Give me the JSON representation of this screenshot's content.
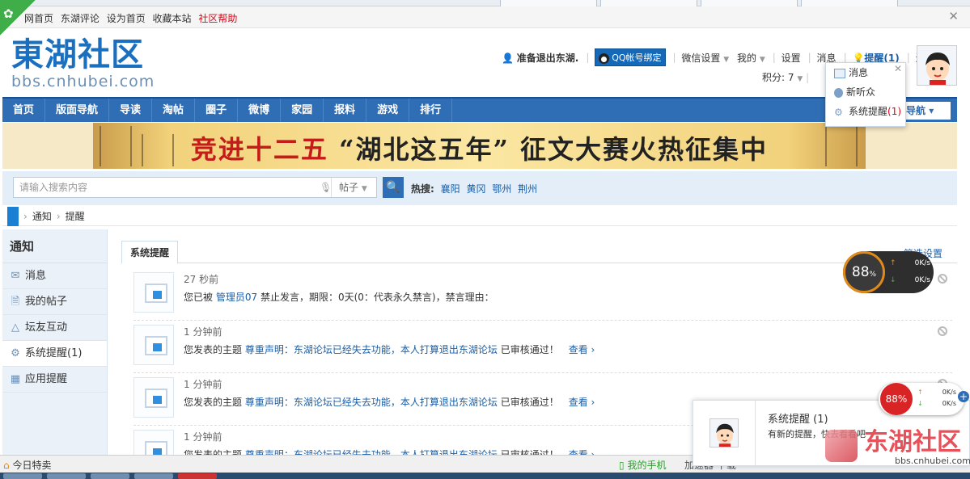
{
  "top_links": {
    "items": [
      "网首页",
      "东湖评论",
      "设为首页",
      "收藏本站"
    ],
    "help": "社区帮助"
  },
  "logo": {
    "name": "東湖社区",
    "url_text": "bbs.cnhubei.com"
  },
  "user_bar": {
    "exit_notice": "准备退出东湖.",
    "qq_bind": "QQ帐号绑定",
    "wechat": "微信设置",
    "mine": "我的",
    "settings": "设置",
    "messages": "消息",
    "remind": "提醒(1)",
    "logout": "退出",
    "points": "积分: 7"
  },
  "remind_dropdown": {
    "items": [
      {
        "label": "消息",
        "count": ""
      },
      {
        "label": "新听众",
        "count": ""
      },
      {
        "label": "系统提醒",
        "count": "(1)"
      }
    ]
  },
  "nav": {
    "items": [
      "首页",
      "版面导航",
      "导读",
      "淘帖",
      "圈子",
      "微博",
      "家园",
      "报料",
      "游戏",
      "排行"
    ],
    "right": "导航"
  },
  "banner": {
    "part1": "竞进十二五",
    "part2": "“湖北这五年”",
    "part3": "征文大赛火热征集中"
  },
  "search": {
    "placeholder": "请输入搜索内容",
    "type": "帖子",
    "hot_label": "热搜:",
    "hot_items": [
      "襄阳",
      "黄冈",
      "鄂州",
      "荆州"
    ]
  },
  "breadcrumb": {
    "items": [
      "通知",
      "提醒"
    ]
  },
  "sidebar": {
    "title": "通知",
    "items": [
      {
        "label": "消息",
        "icon": "envelope-icon"
      },
      {
        "label": "我的帖子",
        "icon": "document-icon"
      },
      {
        "label": "坛友互动",
        "icon": "interaction-icon"
      },
      {
        "label": "系统提醒(1)",
        "icon": "gear-icon"
      },
      {
        "label": "应用提醒",
        "icon": "grid-icon"
      }
    ]
  },
  "main": {
    "tab": "系统提醒",
    "filter": "筛选设置",
    "notices": [
      {
        "time": "27 秒前",
        "text_pre": "您已被",
        "user": "管理员07",
        "text_post": "禁止发言，期限：0天(0：代表永久禁言)，禁言理由：",
        "more": ""
      },
      {
        "time": "1 分钟前",
        "text_pre": "您发表的主题",
        "user": "尊重声明：东湖论坛已经失去功能，本人打算退出东湖论坛",
        "text_post": "已审核通过！",
        "more": "查看 ›"
      },
      {
        "time": "1 分钟前",
        "text_pre": "您发表的主题",
        "user": "尊重声明：东湖论坛已经失去功能，本人打算退出东湖论坛",
        "text_post": "已审核通过！",
        "more": "查看 ›"
      },
      {
        "time": "1 分钟前",
        "text_pre": "您发表的主题",
        "user": "尊重声明：东湖论坛已经失去功能，本人打算退出东湖论坛",
        "text_post": "已审核通过！",
        "more": "查看 ›"
      }
    ]
  },
  "speed_widget_1": {
    "percent": "88",
    "unit": "%",
    "up": "0K/s",
    "down": "0K/s"
  },
  "speed_widget_2": {
    "percent": "88%",
    "up": "0K/s",
    "down": "0K/s"
  },
  "popup": {
    "title": "系统提醒 (1)",
    "message": "有新的提醒，快去看看吧"
  },
  "watermark": {
    "name": "东湖社区",
    "url": "bbs.cnhubei.com"
  },
  "status_bar": {
    "left": "今日特卖",
    "phone": "我的手机",
    "more": "加速器    下载"
  }
}
